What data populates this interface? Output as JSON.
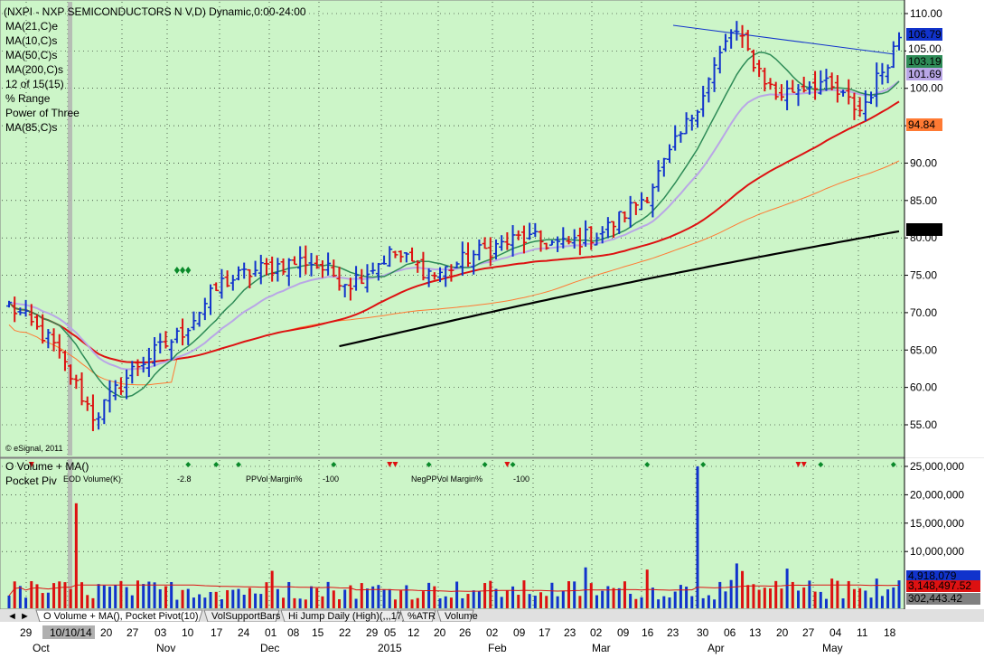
{
  "header": {
    "title": "(NXPI - NXP SEMICONDUCTORS N V,D) Dynamic,0:00-24:00",
    "studies": [
      {
        "text": "MA(21,C)e",
        "color": "#b9a6e6"
      },
      {
        "text": "MA(10,C)s",
        "color": "#2e8b57"
      },
      {
        "text": "MA(50,C)s",
        "color": "#dd1111"
      },
      {
        "text": "MA(200,C)s",
        "color": "#000000"
      },
      {
        "text": "12 of 15(15)",
        "color": "#000000"
      },
      {
        "text": "% Range",
        "color": "#000000"
      },
      {
        "text": "Power of Three",
        "color": "#000000"
      },
      {
        "text": "MA(85,C)s",
        "color": "#ff7a33"
      }
    ],
    "copyright": "© eSignal, 2011"
  },
  "lower_header": {
    "line1": "O Volume + MA()",
    "line2": "Pocket Piv",
    "eod": "EOD Volume(K)",
    "eod_val": "-2.8",
    "ppvol": "PPVol Margin%",
    "ppvol_val": "-100",
    "negpp": "NegPPVol Margin%",
    "negpp_val": "-100"
  },
  "price_axis": {
    "ticks": [
      "110.00",
      "105.00",
      "100.00",
      "95.00",
      "90.00",
      "85.00",
      "80.00",
      "75.00",
      "70.00",
      "65.00",
      "60.00",
      "55.00"
    ],
    "badges": [
      {
        "text": "106.79",
        "bg": "#1133cc",
        "fg": "#ffffff"
      },
      {
        "text": "105.00",
        "bg": "#ffffff",
        "fg": "#000000"
      },
      {
        "text": "103.19",
        "bg": "#2e8b57",
        "fg": "#ffffff"
      },
      {
        "text": "101.69",
        "bg": "#b9a6e6",
        "fg": "#ffffff"
      },
      {
        "text": "94.84",
        "bg": "#ff7a33",
        "fg": "#000000"
      },
      {
        "text": "80.80",
        "bg": "#000000",
        "fg": "#ffffff"
      }
    ]
  },
  "volume_axis": {
    "ticks": [
      "25,000,000",
      "20,000,000",
      "15,000,000",
      "10,000,000"
    ],
    "badges": [
      {
        "text": "4,918,079",
        "bg": "#1133cc",
        "fg": "#ffffff"
      },
      {
        "text": "3,148,497.52",
        "bg": "#dd1111",
        "fg": "#ffffff"
      },
      {
        "text": "302,443.42",
        "bg": "#808080",
        "fg": "#ffffff"
      }
    ]
  },
  "time_axis": {
    "days": [
      "29",
      "10/10/14",
      "20",
      "27",
      "03",
      "10",
      "17",
      "24",
      "01",
      "08",
      "15",
      "22",
      "29",
      "05",
      "12",
      "20",
      "26",
      "02",
      "09",
      "17",
      "23",
      "02",
      "09",
      "16",
      "23",
      "30",
      "06",
      "13",
      "20",
      "27",
      "04",
      "11",
      "18"
    ],
    "months": [
      "Oct",
      "Nov",
      "Dec",
      "2015",
      "Feb",
      "Mar",
      "Apr",
      "May"
    ]
  },
  "tabs": [
    "O Volume + MA(), Pocket Pivot(10)",
    "VolSupportBars",
    "Hi Jump Daily (High)(,,,17)",
    "%ATR",
    "Volume"
  ],
  "colors": {
    "chart_bg": "#ccf5c8",
    "up": "#1133cc",
    "down": "#dd1111",
    "ma10": "#2e8b57",
    "ma21": "#b9a6e6",
    "ma50": "#dd1111",
    "ma85": "#ff7a33",
    "ma200": "#000000"
  },
  "chart_data": [
    {
      "type": "line",
      "title": "(NXPI - NXP SEMICONDUCTORS N V,D) Dynamic,0:00-24:00",
      "ylim": [
        52,
        112
      ],
      "price_anchors_x_days": [
        0,
        10,
        20,
        30,
        40,
        50,
        60,
        70,
        80,
        90,
        100,
        110,
        120,
        130,
        140,
        150,
        160,
        170,
        180,
        190,
        200,
        209
      ],
      "price_anchors_close": [
        71,
        66,
        56,
        63,
        67,
        74,
        76,
        77,
        74,
        78,
        75,
        78,
        80,
        79,
        81,
        86,
        96,
        108,
        99,
        101,
        97,
        106.79
      ],
      "series": [
        {
          "name": "MA(10,C)s",
          "last": 103.19
        },
        {
          "name": "MA(21,C)e",
          "last": 101.69
        },
        {
          "name": "MA(50,C)s",
          "last": 101.0
        },
        {
          "name": "MA(85,C)s",
          "last": 94.84
        },
        {
          "name": "MA(200,C)s",
          "last": 80.8
        }
      ]
    },
    {
      "type": "bar",
      "title": "O Volume + MA()",
      "ylim": [
        0,
        26000000
      ],
      "notable_values": [
        {
          "date": "Oct 14",
          "value": 18500000
        },
        {
          "date": "Mar 02",
          "value": 25000000
        },
        {
          "date": "May 19",
          "value": 4918079
        }
      ],
      "ma_value": 3148497.52
    }
  ]
}
